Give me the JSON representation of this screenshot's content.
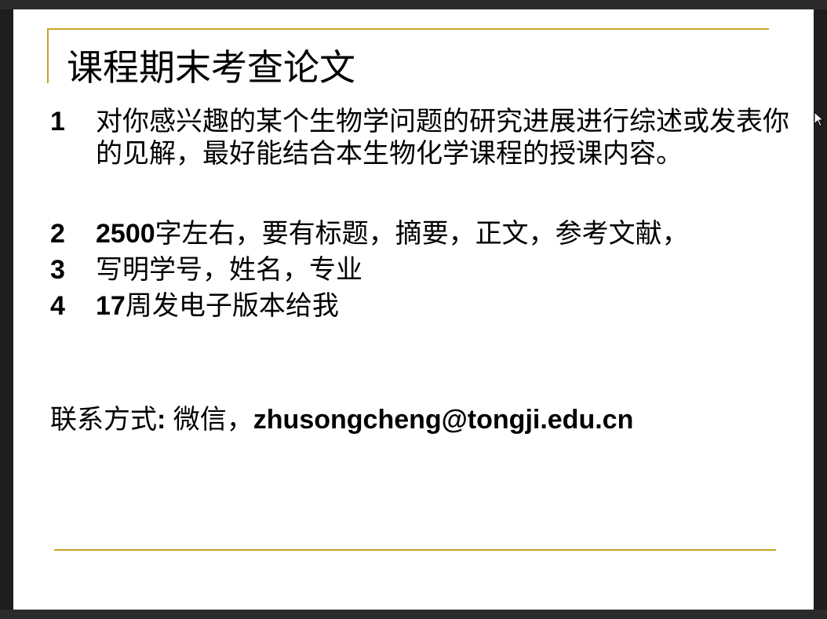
{
  "slide": {
    "title": "课程期末考查论文",
    "items": [
      {
        "number": "1",
        "text": "对你感兴趣的某个生物学问题的研究进展进行综述或发表你的见解，最好能结合本生物化学课程的授课内容。"
      },
      {
        "number": "2",
        "prefix": "2500",
        "text": "字左右，要有标题，摘要，正文，参考文献，"
      },
      {
        "number": "3",
        "text": "写明学号，姓名，专业"
      },
      {
        "number": "4",
        "prefix": "17",
        "text": "周发电子版本给我"
      }
    ],
    "contact": {
      "label": "联系方式",
      "colon": ": ",
      "wechat": "微信，",
      "email": "zhusongcheng@tongji.edu.cn"
    }
  },
  "colors": {
    "accent_rule": "#c9a227",
    "slide_background": "#ffffff",
    "viewer_background": "#1e1e1e"
  },
  "icons": {
    "cursor": "mouse-pointer-icon"
  }
}
